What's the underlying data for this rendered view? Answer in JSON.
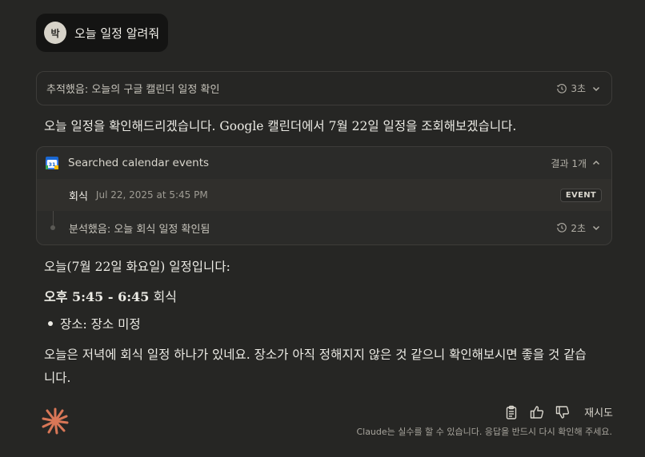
{
  "user_message": {
    "avatar_initial": "박",
    "text": "오늘 일정 알려줘"
  },
  "thinking_block": {
    "label": "추적했음: 오늘의 구글 캘린더 일정 확인",
    "duration": "3초"
  },
  "intro_text": "오늘 일정을 확인해드리겠습니다. Google 캘린더에서 7월 22일 일정을 조회해보겠습니다.",
  "tool_card": {
    "title": "Searched calendar events",
    "result_count": "결과 1개",
    "calendar_icon_day": "31",
    "event": {
      "name": "회식",
      "datetime": "Jul 22, 2025 at 5:45 PM",
      "badge": "EVENT"
    },
    "analysis": {
      "label": "분석했음: 오늘 회식 일정 확인됨",
      "duration": "2초"
    }
  },
  "response": {
    "heading": "오늘(7월 22일 화요일) 일정입니다:",
    "event_time": "오후 5:45 - 6:45",
    "event_name": " 회식",
    "bullet": "장소: 장소 미정",
    "closing": "오늘은 저녁에 회식 일정 하나가 있네요. 장소가 아직 정해지지 않은 것 같으니 확인해보시면 좋을 것 같습니다."
  },
  "actions": {
    "icons": [
      "copy-icon",
      "thumbs-up-icon",
      "thumbs-down-icon"
    ],
    "retry_label": "재시도",
    "disclaimer": "Claude는 실수를 할 수 있습니다. 응답을 반드시 다시 확인해 주세요."
  },
  "colors": {
    "background": "#262624",
    "accent": "#d97757"
  }
}
